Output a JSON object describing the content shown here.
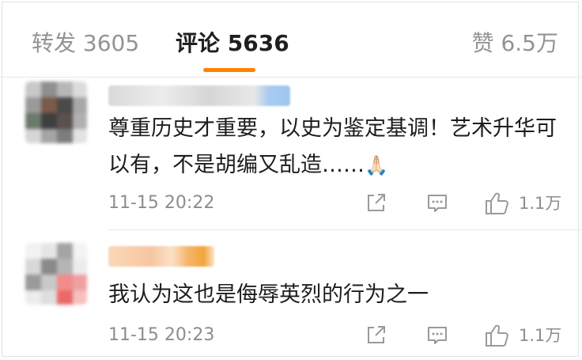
{
  "tabs": {
    "repost": "转发 3605",
    "comments": "评论 5636",
    "likes": "赞 6.5万"
  },
  "colors": {
    "accent": "#ff8200",
    "muted_text": "#8d8d8d",
    "icon": "#9a9a9a"
  },
  "comments": [
    {
      "text": "尊重历史才重要，以史为鉴定基调！艺术升华可以有，不是胡编又乱造……",
      "emoji": "🙏🏻",
      "timestamp": "11-15 20:22",
      "like_count": "1.1万",
      "icons": [
        "share-icon",
        "comment-icon",
        "like-icon"
      ]
    },
    {
      "text": "我认为这也是侮辱英烈的行为之一",
      "timestamp": "11-15 20:23",
      "like_count": "1.1万",
      "icons": [
        "share-icon",
        "comment-icon",
        "like-icon"
      ]
    }
  ]
}
